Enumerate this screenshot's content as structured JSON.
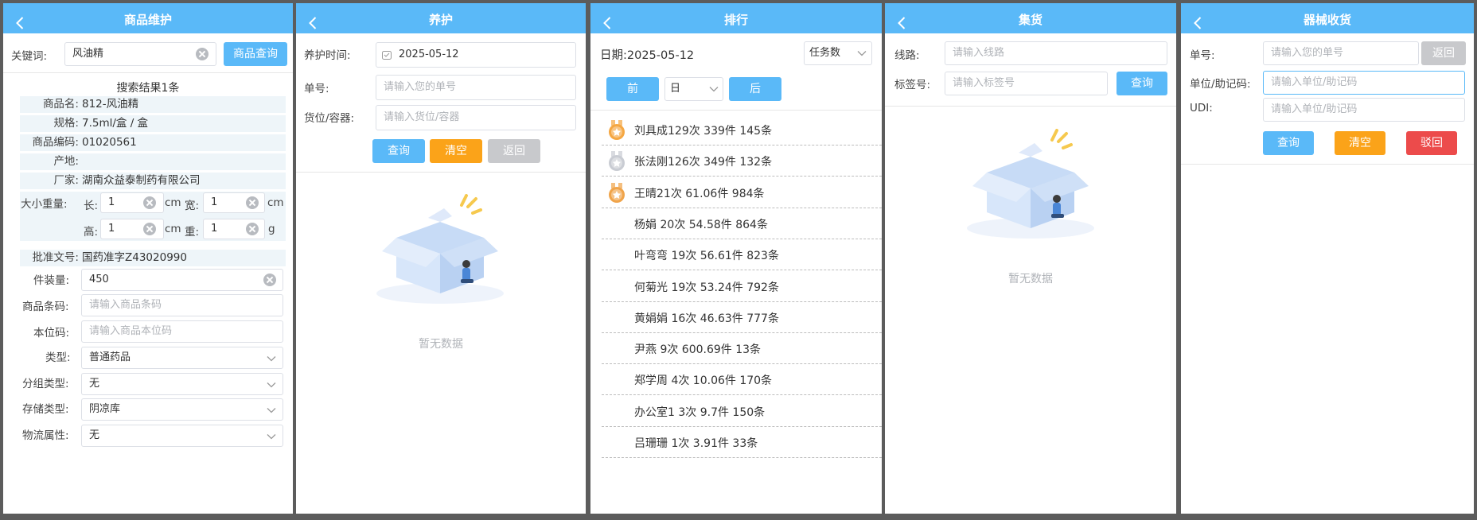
{
  "colors": {
    "header": "#5ab9f8",
    "primary": "#5ab9f8",
    "warning": "#fba319",
    "disabled": "#c8c9cc",
    "danger": "#ec4b4b"
  },
  "p1": {
    "title": "商品维护",
    "keyword_label": "关键词:",
    "keyword_value": "风油精",
    "query_btn": "商品查询",
    "result": "搜索结果1条",
    "rows": [
      {
        "k": "商品名:",
        "v": "812-风油精"
      },
      {
        "k": "规格:",
        "v": "7.5ml/盒 / 盒"
      },
      {
        "k": "商品编码:",
        "v": "01020561"
      },
      {
        "k": "产地:",
        "v": ""
      },
      {
        "k": "厂家:",
        "v": "湖南众益泰制药有限公司"
      }
    ],
    "size_label": "大小重量:",
    "len_label": "长:",
    "len_value": "1",
    "len_unit": "cm",
    "wid_label": "宽:",
    "wid_value": "1",
    "wid_unit": "cm",
    "hgt_label": "高:",
    "hgt_value": "1",
    "hgt_unit": "cm",
    "wgt_label": "重:",
    "wgt_value": "1",
    "wgt_unit": "g",
    "approval_label": "批准文号:",
    "approval_value": "国药准字Z43020990",
    "pack_label": "件装量:",
    "pack_value": "450",
    "barcode_label": "商品条码:",
    "barcode_ph": "请输入商品条码",
    "loc_label": "本位码:",
    "loc_ph": "请输入商品本位码",
    "type_label": "类型:",
    "type_value": "普通药品",
    "group_label": "分组类型:",
    "group_value": "无",
    "storage_label": "存储类型:",
    "storage_value": "阴凉库",
    "logistics_label": "物流属性:",
    "logistics_value": "无"
  },
  "p2": {
    "title": "养护",
    "time_label": "养护时间:",
    "time_value": "2025-05-12",
    "order_label": "单号:",
    "order_ph": "请输入您的单号",
    "slot_label": "货位/容器:",
    "slot_ph": "请输入货位/容器",
    "query_btn": "查询",
    "clear_btn": "清空",
    "back_btn": "返回",
    "empty_text": "暂无数据"
  },
  "p3": {
    "title": "排行",
    "date_label": "日期:2025-05-12",
    "sort_value": "任务数",
    "prev_btn": "前",
    "unit_value": "日",
    "next_btn": "后",
    "ranking": [
      {
        "text": "刘具成129次 339件 145条",
        "medal": "gold"
      },
      {
        "text": "张法刚126次 349件 132条",
        "medal": "silver"
      },
      {
        "text": "王晴21次 61.06件 984条",
        "medal": "bronze"
      },
      {
        "text": "杨娟 20次 54.58件 864条",
        "medal": ""
      },
      {
        "text": "叶弯弯 19次 56.61件 823条",
        "medal": ""
      },
      {
        "text": "何菊光 19次 53.24件 792条",
        "medal": ""
      },
      {
        "text": "黄娟娟 16次 46.63件 777条",
        "medal": ""
      },
      {
        "text": "尹燕 9次 600.69件 13条",
        "medal": ""
      },
      {
        "text": "郑学周 4次 10.06件 170条",
        "medal": ""
      },
      {
        "text": "办公室1 3次 9.7件 150条",
        "medal": ""
      },
      {
        "text": "吕珊珊 1次 3.91件 33条",
        "medal": ""
      }
    ]
  },
  "p4": {
    "title": "集货",
    "route_label": "线路:",
    "route_ph": "请输入线路",
    "tag_label": "标签号:",
    "tag_ph": "请输入标签号",
    "query_btn": "查询",
    "empty_text": "暂无数据"
  },
  "p5": {
    "title": "器械收货",
    "order_label": "单号:",
    "order_ph": "请输入您的单号",
    "back_btn": "返回",
    "unit_label": "单位/助记码:",
    "unit_ph": "请输入单位/助记码",
    "udi_label": "UDI:",
    "udi_ph": "请输入单位/助记码",
    "query_btn": "查询",
    "clear_btn": "清空",
    "reject_btn": "驳回"
  }
}
